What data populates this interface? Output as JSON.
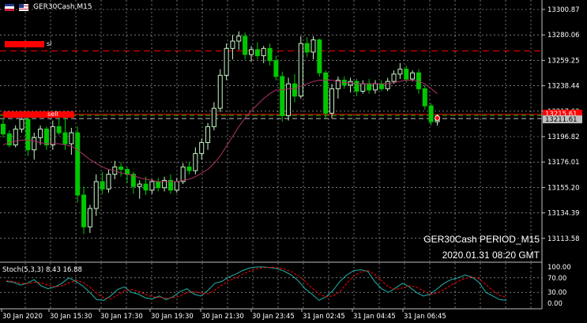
{
  "window": {
    "symbol_title": "GER30Cash,M15",
    "icon": "flag-icon"
  },
  "overlay": {
    "instrument_line": "GER30Cash PERIOD_M15",
    "datetime_line": "2020.01.31 08:20 GMT"
  },
  "orders": [
    {
      "label": "sl",
      "price": 13267.0,
      "color": "#ff0000"
    },
    {
      "label": "sell",
      "price": 13215.0,
      "color": "#ff0000"
    }
  ],
  "price_axis": {
    "labels": [
      "13300.87",
      "13280.06",
      "13259.25",
      "13238.44",
      "13217.63",
      "13196.82",
      "13176.01",
      "13155.20",
      "13134.39",
      "13113.58"
    ],
    "bid_label": "13211.61",
    "ask_label": "13215.61"
  },
  "stoch": {
    "label": "Stoch(5,3,3) 8.43 16.88",
    "levels": [
      "100.00",
      "70.00",
      "30.00",
      "0.00"
    ]
  },
  "time_axis": {
    "labels": [
      "30 Jan 2020",
      "30 Jan 15:30",
      "30 Jan 17:30",
      "30 Jan 19:30",
      "30 Jan 21:30",
      "30 Jan 23:45",
      "31 Jan 02:45",
      "31 Jan 04:45",
      "31 Jan 06:45"
    ]
  },
  "colors": {
    "background": "#000000",
    "grid": "#c0c0c0",
    "bull_candle": "#c8f7c5",
    "bear_candle": "#00c800",
    "ma_line": "#b0306a",
    "stoch_main": "#20b2aa",
    "stoch_signal": "#ff0000"
  },
  "chart_data": {
    "type": "candlestick",
    "timeframe": "M15",
    "candles": [
      {
        "o": 13207,
        "h": 13212,
        "l": 13196,
        "c": 13199
      },
      {
        "o": 13199,
        "h": 13202,
        "l": 13188,
        "c": 13190
      },
      {
        "o": 13190,
        "h": 13206,
        "l": 13188,
        "c": 13203
      },
      {
        "o": 13203,
        "h": 13214,
        "l": 13200,
        "c": 13211
      },
      {
        "o": 13211,
        "h": 13213,
        "l": 13181,
        "c": 13186
      },
      {
        "o": 13186,
        "h": 13200,
        "l": 13178,
        "c": 13196
      },
      {
        "o": 13196,
        "h": 13206,
        "l": 13190,
        "c": 13203
      },
      {
        "o": 13203,
        "h": 13205,
        "l": 13186,
        "c": 13190
      },
      {
        "o": 13190,
        "h": 13210,
        "l": 13186,
        "c": 13205
      },
      {
        "o": 13205,
        "h": 13212,
        "l": 13198,
        "c": 13200
      },
      {
        "o": 13200,
        "h": 13216,
        "l": 13186,
        "c": 13191
      },
      {
        "o": 13191,
        "h": 13204,
        "l": 13182,
        "c": 13200
      },
      {
        "o": 13200,
        "h": 13205,
        "l": 13143,
        "c": 13149
      },
      {
        "o": 13149,
        "h": 13156,
        "l": 13117,
        "c": 13123
      },
      {
        "o": 13123,
        "h": 13141,
        "l": 13118,
        "c": 13138
      },
      {
        "o": 13138,
        "h": 13166,
        "l": 13132,
        "c": 13160
      },
      {
        "o": 13160,
        "h": 13168,
        "l": 13150,
        "c": 13154
      },
      {
        "o": 13154,
        "h": 13170,
        "l": 13151,
        "c": 13166
      },
      {
        "o": 13166,
        "h": 13177,
        "l": 13162,
        "c": 13172
      },
      {
        "o": 13172,
        "h": 13176,
        "l": 13164,
        "c": 13170
      },
      {
        "o": 13170,
        "h": 13172,
        "l": 13159,
        "c": 13166
      },
      {
        "o": 13166,
        "h": 13168,
        "l": 13150,
        "c": 13156
      },
      {
        "o": 13156,
        "h": 13161,
        "l": 13146,
        "c": 13158
      },
      {
        "o": 13158,
        "h": 13164,
        "l": 13149,
        "c": 13153
      },
      {
        "o": 13153,
        "h": 13162,
        "l": 13150,
        "c": 13160
      },
      {
        "o": 13160,
        "h": 13163,
        "l": 13152,
        "c": 13155
      },
      {
        "o": 13155,
        "h": 13164,
        "l": 13152,
        "c": 13161
      },
      {
        "o": 13161,
        "h": 13166,
        "l": 13150,
        "c": 13153
      },
      {
        "o": 13153,
        "h": 13163,
        "l": 13151,
        "c": 13160
      },
      {
        "o": 13160,
        "h": 13175,
        "l": 13158,
        "c": 13172
      },
      {
        "o": 13172,
        "h": 13176,
        "l": 13166,
        "c": 13169
      },
      {
        "o": 13169,
        "h": 13188,
        "l": 13166,
        "c": 13183
      },
      {
        "o": 13183,
        "h": 13195,
        "l": 13178,
        "c": 13192
      },
      {
        "o": 13192,
        "h": 13208,
        "l": 13186,
        "c": 13205
      },
      {
        "o": 13205,
        "h": 13225,
        "l": 13202,
        "c": 13220
      },
      {
        "o": 13220,
        "h": 13252,
        "l": 13217,
        "c": 13247
      },
      {
        "o": 13247,
        "h": 13273,
        "l": 13243,
        "c": 13269
      },
      {
        "o": 13269,
        "h": 13280,
        "l": 13260,
        "c": 13275
      },
      {
        "o": 13275,
        "h": 13283,
        "l": 13268,
        "c": 13279
      },
      {
        "o": 13279,
        "h": 13282,
        "l": 13260,
        "c": 13264
      },
      {
        "o": 13264,
        "h": 13271,
        "l": 13258,
        "c": 13268
      },
      {
        "o": 13268,
        "h": 13274,
        "l": 13260,
        "c": 13263
      },
      {
        "o": 13263,
        "h": 13271,
        "l": 13257,
        "c": 13269
      },
      {
        "o": 13269,
        "h": 13273,
        "l": 13255,
        "c": 13259
      },
      {
        "o": 13259,
        "h": 13263,
        "l": 13243,
        "c": 13246
      },
      {
        "o": 13246,
        "h": 13250,
        "l": 13209,
        "c": 13214
      },
      {
        "o": 13214,
        "h": 13245,
        "l": 13210,
        "c": 13240
      },
      {
        "o": 13240,
        "h": 13248,
        "l": 13225,
        "c": 13230
      },
      {
        "o": 13230,
        "h": 13279,
        "l": 13228,
        "c": 13273
      },
      {
        "o": 13273,
        "h": 13278,
        "l": 13262,
        "c": 13266
      },
      {
        "o": 13266,
        "h": 13279,
        "l": 13260,
        "c": 13276
      },
      {
        "o": 13276,
        "h": 13277,
        "l": 13246,
        "c": 13249
      },
      {
        "o": 13249,
        "h": 13251,
        "l": 13212,
        "c": 13216
      },
      {
        "o": 13216,
        "h": 13240,
        "l": 13212,
        "c": 13236
      },
      {
        "o": 13236,
        "h": 13246,
        "l": 13228,
        "c": 13243
      },
      {
        "o": 13243,
        "h": 13246,
        "l": 13236,
        "c": 13239
      },
      {
        "o": 13239,
        "h": 13245,
        "l": 13233,
        "c": 13242
      },
      {
        "o": 13242,
        "h": 13244,
        "l": 13230,
        "c": 13234
      },
      {
        "o": 13234,
        "h": 13243,
        "l": 13232,
        "c": 13240
      },
      {
        "o": 13240,
        "h": 13244,
        "l": 13232,
        "c": 13235
      },
      {
        "o": 13235,
        "h": 13243,
        "l": 13232,
        "c": 13240
      },
      {
        "o": 13240,
        "h": 13243,
        "l": 13234,
        "c": 13236
      },
      {
        "o": 13236,
        "h": 13245,
        "l": 13234,
        "c": 13242
      },
      {
        "o": 13242,
        "h": 13251,
        "l": 13240,
        "c": 13248
      },
      {
        "o": 13248,
        "h": 13257,
        "l": 13244,
        "c": 13252
      },
      {
        "o": 13252,
        "h": 13255,
        "l": 13241,
        "c": 13244
      },
      {
        "o": 13244,
        "h": 13251,
        "l": 13242,
        "c": 13249
      },
      {
        "o": 13249,
        "h": 13252,
        "l": 13232,
        "c": 13236
      },
      {
        "o": 13236,
        "h": 13239,
        "l": 13219,
        "c": 13222
      },
      {
        "o": 13222,
        "h": 13224,
        "l": 13206,
        "c": 13209
      },
      {
        "o": 13209,
        "h": 13215,
        "l": 13206,
        "c": 13212
      }
    ],
    "ma": [
      13190,
      13192,
      13193,
      13194,
      13194,
      13193,
      13192,
      13191,
      13191,
      13191,
      13190,
      13189,
      13186,
      13182,
      13178,
      13175,
      13172,
      13170,
      13169,
      13167,
      13166,
      13165,
      13163,
      13162,
      13161,
      13160,
      13160,
      13160,
      13160,
      13161,
      13162,
      13164,
      13167,
      13170,
      13175,
      13181,
      13189,
      13197,
      13205,
      13212,
      13218,
      13223,
      13228,
      13232,
      13235,
      13235,
      13236,
      13236,
      13238,
      13240,
      13242,
      13243,
      13243,
      13243,
      13242,
      13241,
      13241,
      13240,
      13240,
      13240,
      13240,
      13240,
      13240,
      13241,
      13242,
      13243,
      13243,
      13242,
      13240,
      13236,
      13232
    ],
    "stoch_main": [
      60,
      58,
      50,
      55,
      65,
      48,
      40,
      45,
      55,
      70,
      60,
      48,
      30,
      10,
      8,
      20,
      38,
      45,
      30,
      25,
      15,
      12,
      20,
      10,
      18,
      32,
      40,
      25,
      20,
      35,
      55,
      60,
      72,
      80,
      90,
      97,
      100,
      100,
      98,
      95,
      88,
      78,
      62,
      40,
      25,
      8,
      18,
      35,
      60,
      78,
      90,
      92,
      88,
      60,
      40,
      30,
      42,
      55,
      45,
      30,
      20,
      25,
      40,
      55,
      65,
      70,
      78,
      72,
      58,
      30,
      20,
      10,
      8
    ],
    "stoch_signal": [
      62,
      60,
      55,
      54,
      58,
      56,
      50,
      45,
      48,
      56,
      62,
      58,
      45,
      28,
      15,
      12,
      22,
      35,
      38,
      33,
      25,
      18,
      16,
      14,
      15,
      20,
      30,
      32,
      28,
      26,
      36,
      50,
      62,
      70,
      80,
      88,
      95,
      98,
      99,
      98,
      94,
      87,
      76,
      60,
      42,
      25,
      18,
      20,
      32,
      55,
      75,
      86,
      90,
      80,
      62,
      45,
      38,
      42,
      48,
      44,
      35,
      25,
      28,
      38,
      50,
      60,
      68,
      73,
      68,
      52,
      35,
      22,
      16
    ]
  }
}
